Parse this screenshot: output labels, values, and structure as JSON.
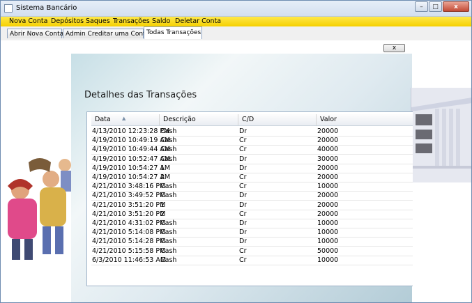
{
  "window": {
    "title": "Sistema Bancário",
    "minimize_label": "–",
    "maximize_label": "□",
    "close_label": "x"
  },
  "menu": [
    "Nova Conta",
    "Depósitos",
    "Saques",
    "Transações",
    "Saldo",
    "Deletar Conta"
  ],
  "tabs": [
    "Abrir Nova Conta",
    "Admin Creditar uma Conta",
    "Todas Transações"
  ],
  "active_tab": 2,
  "close_button_label": "x",
  "section_title": "Detalhes das Transações",
  "table": {
    "columns": [
      "Data",
      "Descrição",
      "C/D",
      "Valor"
    ],
    "rows": [
      [
        "4/13/2010 12:23:28 PM",
        "Cash",
        "Dr",
        "20000"
      ],
      [
        "4/19/2010 10:49:19 AM",
        "Cash",
        "Cr",
        "20000"
      ],
      [
        "4/19/2010 10:49:44 AM",
        "Cash",
        "Cr",
        "40000"
      ],
      [
        "4/19/2010 10:52:47 AM",
        "Cash",
        "Dr",
        "30000"
      ],
      [
        "4/19/2010 10:54:27 AM",
        "1",
        "Dr",
        "20000"
      ],
      [
        "4/19/2010 10:54:27 AM",
        "2",
        "Cr",
        "20000"
      ],
      [
        "4/21/2010 3:48:16 PM",
        "Cash",
        "Cr",
        "10000"
      ],
      [
        "4/21/2010 3:49:52 PM",
        "Cash",
        "Dr",
        "20000"
      ],
      [
        "4/21/2010 3:51:20 PM",
        "1",
        "Dr",
        "20000"
      ],
      [
        "4/21/2010 3:51:20 PM",
        "2",
        "Cr",
        "20000"
      ],
      [
        "4/21/2010 4:31:02 PM",
        "Cash",
        "Dr",
        "10000"
      ],
      [
        "4/21/2010 5:14:08 PM",
        "Cash",
        "Dr",
        "10000"
      ],
      [
        "4/21/2010 5:14:28 PM",
        "Cash",
        "Dr",
        "10000"
      ],
      [
        "4/21/2010 5:15:58 PM",
        "Cash",
        "Cr",
        "50000"
      ],
      [
        "6/3/2010 11:46:53 AM",
        "Cash",
        "Cr",
        "10000"
      ]
    ]
  },
  "colors": {
    "menu_bg": "#f5d000",
    "window_border": "#6d8bb0",
    "close_button": "#c24a35"
  }
}
